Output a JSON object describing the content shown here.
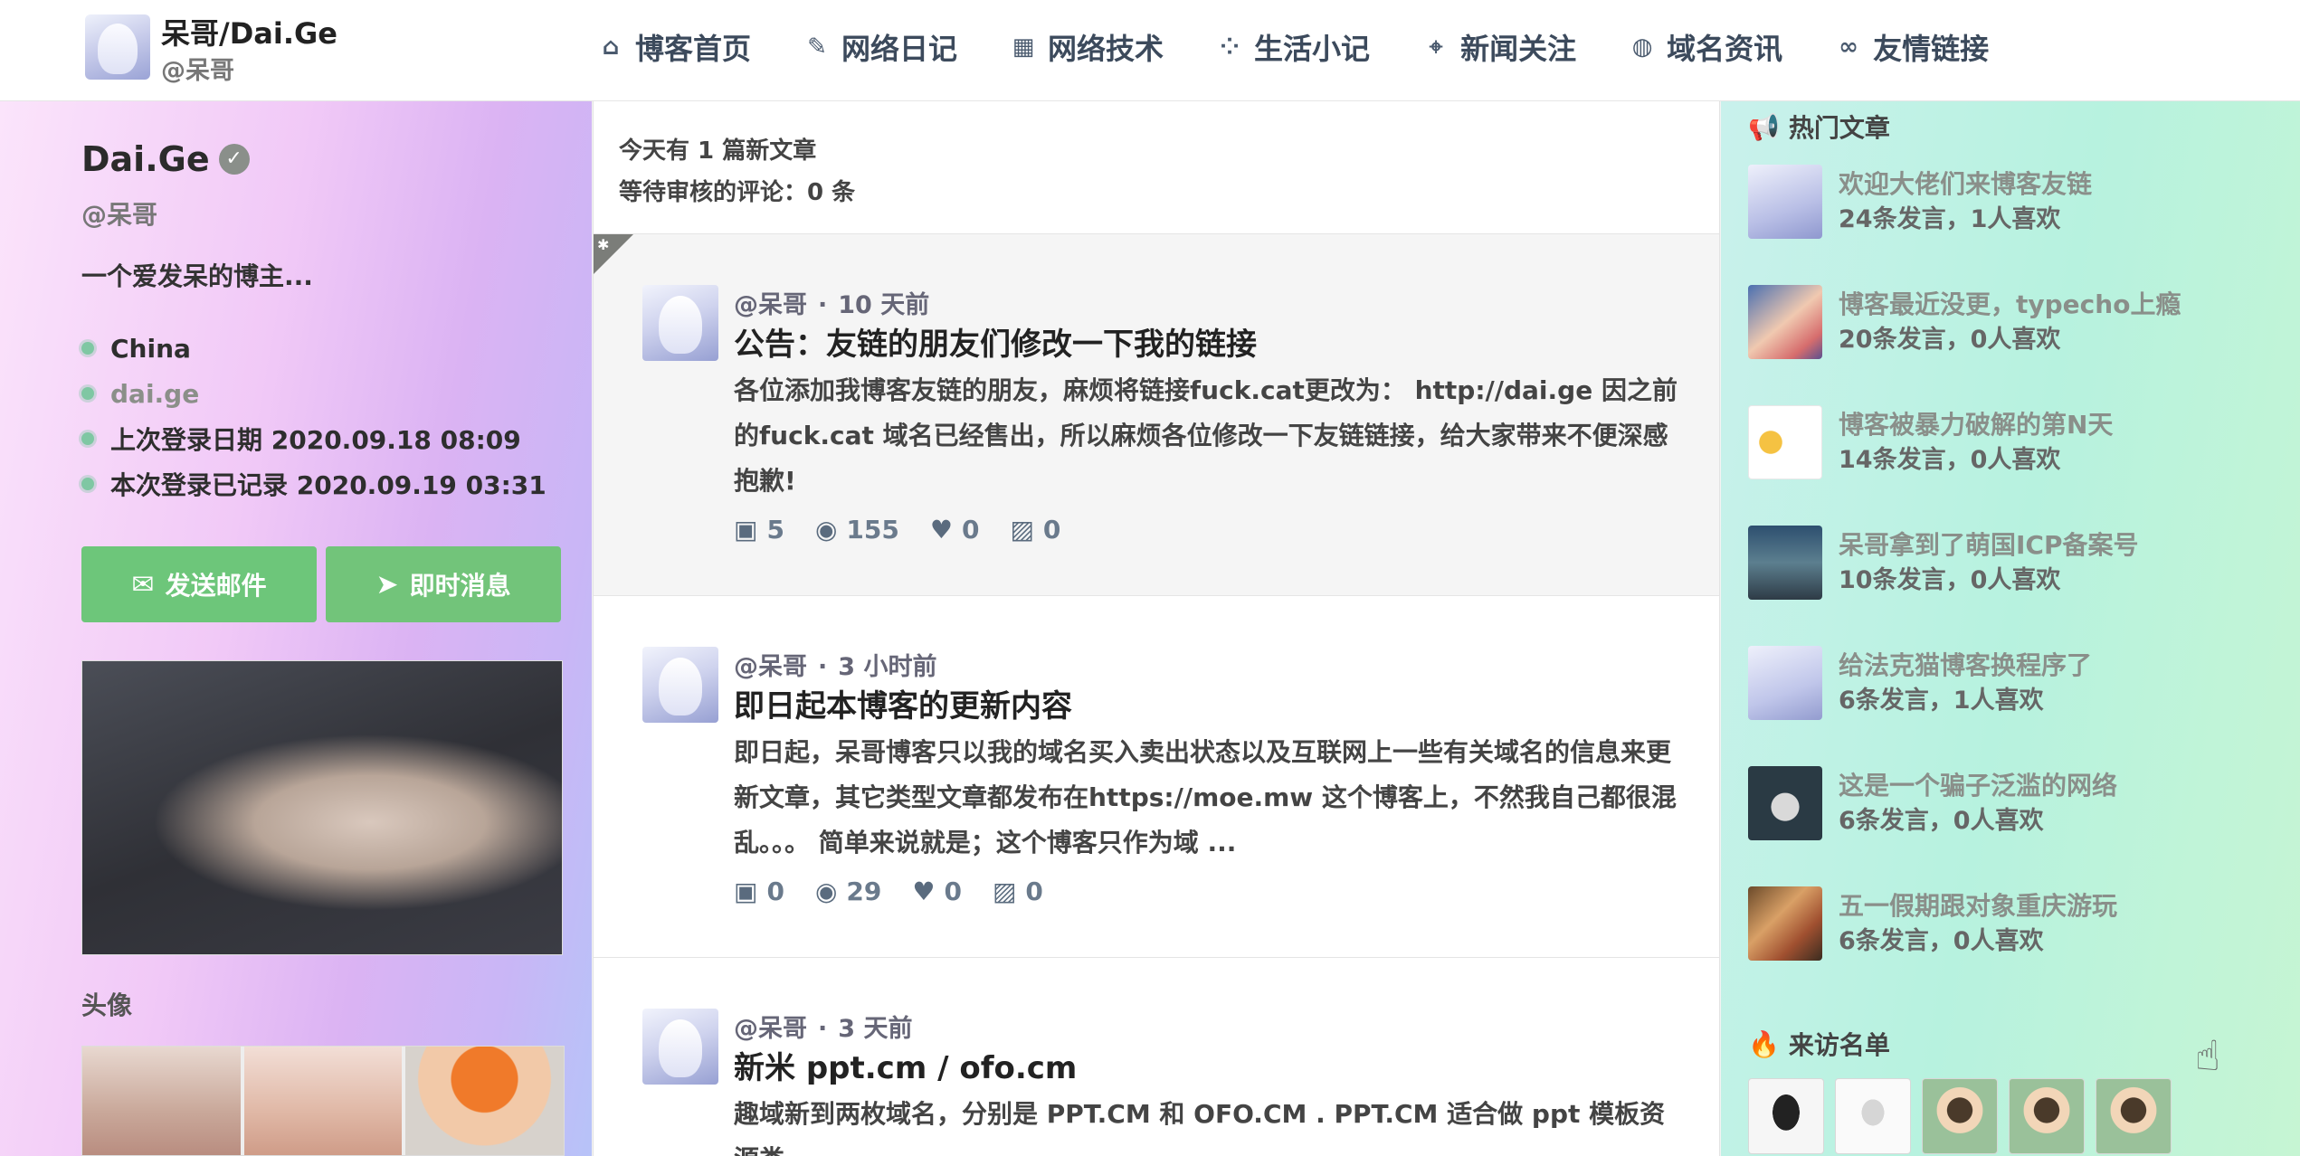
{
  "header": {
    "site_title": "呆哥/Dai.Ge",
    "site_handle": "@呆哥",
    "nav": [
      {
        "label": "博客首页",
        "icon": "home-icon",
        "glyph": "⌂"
      },
      {
        "label": "网络日记",
        "icon": "edit-icon",
        "glyph": "✎"
      },
      {
        "label": "网络技术",
        "icon": "grid-icon",
        "glyph": "▦"
      },
      {
        "label": "生活小记",
        "icon": "nodes-icon",
        "glyph": "⁘"
      },
      {
        "label": "新闻关注",
        "icon": "map-pin-icon",
        "glyph": "⌖"
      },
      {
        "label": "域名资讯",
        "icon": "globe-icon",
        "glyph": "◍"
      },
      {
        "label": "友情链接",
        "icon": "link-icon",
        "glyph": "∞"
      }
    ]
  },
  "profile": {
    "name": "Dai.Ge",
    "handle": "@呆哥",
    "bio": "一个爱发呆的博主...",
    "meta": [
      {
        "text": "China"
      },
      {
        "text": "dai.ge"
      },
      {
        "text": "上次登录日期 2020.09.18 08:09"
      },
      {
        "text": "本次登录已记录 2020.09.19 03:31"
      }
    ],
    "email_button": "发送邮件",
    "message_button": "即时消息",
    "avatars_title": "头像"
  },
  "feed": {
    "notice_new": "今天有 1 篇新文章",
    "notice_pending": "等待审核的评论：0 条",
    "posts": [
      {
        "author": "@呆哥",
        "time": "10 天前",
        "title": "公告：友链的朋友们修改一下我的链接",
        "excerpt": "各位添加我博客友链的朋友，麻烦将链接fuck.cat更改为： http://dai.ge 因之前的fuck.cat 域名已经售出，所以麻烦各位修改一下友链链接，给大家带来不便深感抱歉!",
        "comments": "5",
        "views": "155",
        "likes": "0",
        "images": "0"
      },
      {
        "author": "@呆哥",
        "time": "3 小时前",
        "title": "即日起本博客的更新内容",
        "excerpt": "即日起，呆哥博客只以我的域名买入卖出状态以及互联网上一些有关域名的信息来更新文章，其它类型文章都发布在https://moe.mw 这个博客上，不然我自己都很混乱。。。 简单来说就是；这个博客只作为域 ...",
        "comments": "0",
        "views": "29",
        "likes": "0",
        "images": "0"
      },
      {
        "author": "@呆哥",
        "time": "3 天前",
        "title": "新米 ppt.cm / ofo.cm",
        "excerpt": "趣域新到两枚域名，分别是 PPT.CM 和 OFO.CM . PPT.CM 适合做 ppt 模板资源类"
      }
    ]
  },
  "sidebar": {
    "hot_title": "热门文章",
    "hot": [
      {
        "title": "欢迎大佬们来博客友链",
        "sub": "24条发言，1人喜欢"
      },
      {
        "title": "博客最近没更，typecho上瘾",
        "sub": "20条发言，0人喜欢"
      },
      {
        "title": "博客被暴力破解的第N天",
        "sub": "14条发言，0人喜欢"
      },
      {
        "title": "呆哥拿到了萌国ICP备案号",
        "sub": "10条发言，0人喜欢"
      },
      {
        "title": "给法克猫博客换程序了",
        "sub": "6条发言，1人喜欢"
      },
      {
        "title": "这是一个骗子泛滥的网络",
        "sub": "6条发言，0人喜欢"
      },
      {
        "title": "五一假期跟对象重庆游玩",
        "sub": "6条发言，0人喜欢"
      }
    ],
    "visitors_title": "来访名单"
  }
}
